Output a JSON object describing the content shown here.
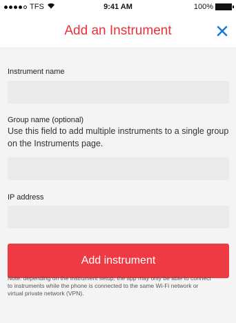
{
  "status_bar": {
    "carrier": "TFS",
    "time": "9:41 AM",
    "battery": "100%"
  },
  "header": {
    "title": "Add an Instrument",
    "close_icon": "close-icon"
  },
  "form": {
    "instrument_name_label": "Instrument name",
    "group_name_label": "Group name (optional)",
    "group_help": "Use this field to add multiple instruments to a single group on the Instruments page.",
    "ip_address_label": "IP address",
    "submit_label": "Add instrument",
    "note": "Note: depending on the instrument setup, the app may only be able to connect to instruments while the phone is connected to the same Wi-Fi network or virtual private network (VPN)."
  },
  "colors": {
    "accent_red": "#ee3b43",
    "close_blue": "#1a7ad6"
  }
}
